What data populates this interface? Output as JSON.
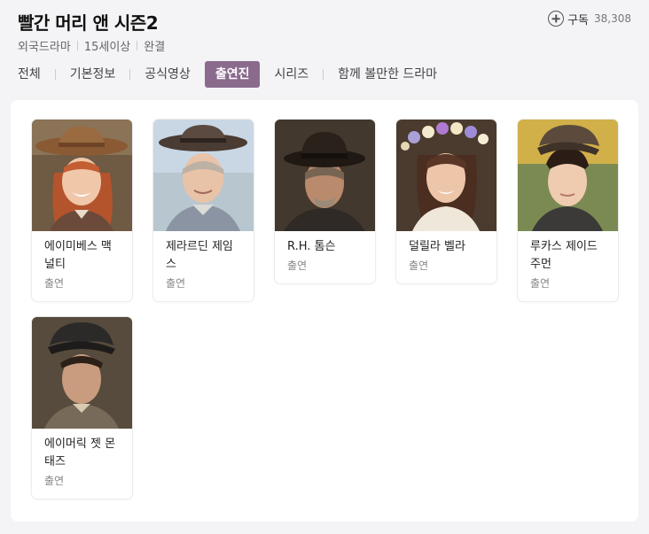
{
  "header": {
    "title": "빨간 머리 앤 시즌2",
    "subscribe_label": "구독",
    "subscribe_count": "38,308",
    "meta": [
      "외국드라마",
      "15세이상",
      "완결"
    ]
  },
  "tabs": [
    {
      "label": "전체",
      "active": false
    },
    {
      "label": "기본정보",
      "active": false
    },
    {
      "label": "공식영상",
      "active": false
    },
    {
      "label": "출연진",
      "active": true
    },
    {
      "label": "시리즈",
      "active": false
    },
    {
      "label": "함께 볼만한 드라마",
      "active": false
    }
  ],
  "cast": [
    {
      "name": "에이미베스 맥널티",
      "role": "출연",
      "photo": "portrait-red-hair-girl-hat"
    },
    {
      "name": "제라르딘 제임스",
      "role": "출연",
      "photo": "portrait-older-woman-hat"
    },
    {
      "name": "R.H. 톰슨",
      "role": "출연",
      "photo": "portrait-older-man-hat"
    },
    {
      "name": "덜릴라 벨라",
      "role": "출연",
      "photo": "portrait-girl-flower-crown"
    },
    {
      "name": "루카스 제이드 주먼",
      "role": "출연",
      "photo": "portrait-young-man-cap"
    },
    {
      "name": "에이머릭 젯 몬태즈",
      "role": "출연",
      "photo": "portrait-boy-cap"
    }
  ],
  "colors": {
    "accent": "#8a6b8e",
    "background": "#f4f3f5"
  }
}
